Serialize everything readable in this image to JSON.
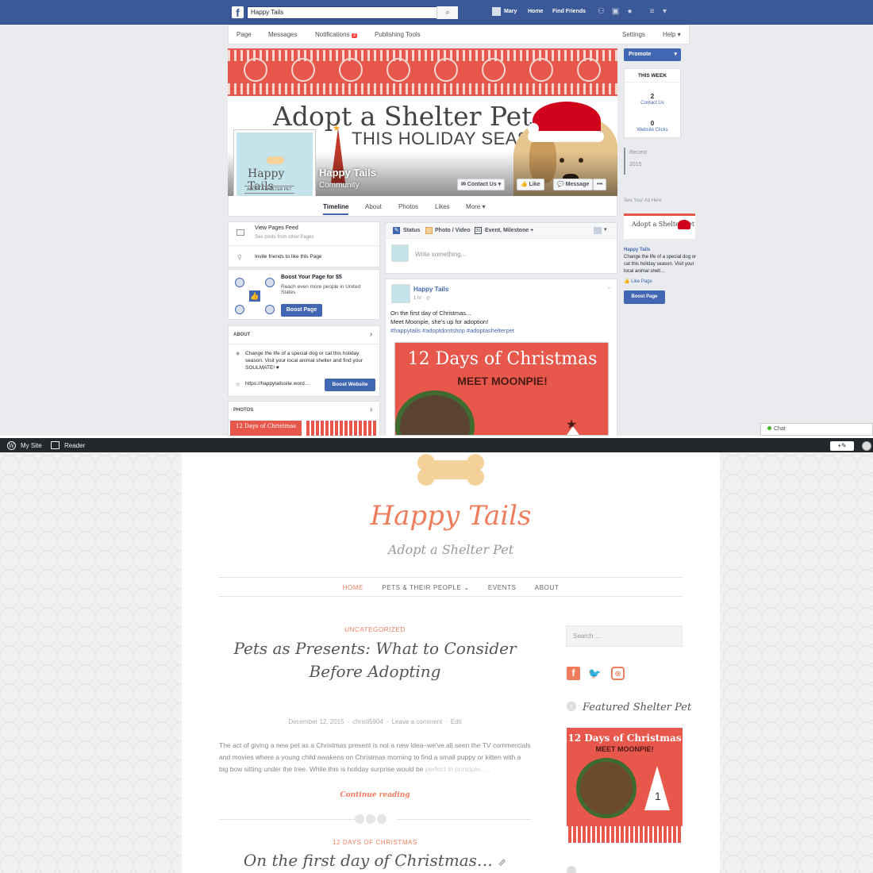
{
  "facebook": {
    "search": {
      "value": "Happy Tails",
      "icon": "search-icon"
    },
    "topnav": {
      "user": "Mary",
      "home": "Home",
      "find_friends": "Find Friends"
    },
    "tabs": {
      "page": "Page",
      "messages": "Messages",
      "notifications": "Notifications",
      "notifications_count": "3",
      "publishing_tools": "Publishing Tools",
      "settings": "Settings",
      "help": "Help ▾"
    },
    "cover": {
      "title": "Adopt a Shelter Pet",
      "subtitle": "THIS HOLIDAY SEASON"
    },
    "profile": {
      "logo_name": "Happy Tails",
      "logo_tagline": "ADOPT A SHELTER PET"
    },
    "page": {
      "name": "Happy Tails",
      "category": "Community"
    },
    "cover_buttons": {
      "contact": "✉ Contact Us ▾",
      "like": "👍 Like",
      "message": "💬 Message",
      "more": "•••"
    },
    "subnav": {
      "timeline": "Timeline",
      "about": "About",
      "photos": "Photos",
      "likes": "Likes",
      "more": "More ▾"
    },
    "right": {
      "promote": "Promote",
      "this_week": "THIS WEEK",
      "contact_count": "2",
      "contact_label": "Contact Us",
      "clicks_count": "0",
      "clicks_label": "Website Clicks",
      "recent": "Recent",
      "year": "2015",
      "ad_label": "See Your Ad Here",
      "ad_title": "Happy Tails",
      "ad_text": "Change the life of a special dog or cat this holiday season. Visit your local animal shelt…",
      "like_page": "Like Page",
      "boost_page": "Boost Page"
    },
    "left": {
      "pages_feed": "View Pages Feed",
      "pages_feed_sub": "See posts from other Pages",
      "invite": "Invite friends to like this Page",
      "boost_title": "Boost Your Page for $5",
      "boost_text": "Reach even more people in United States",
      "boost_button": "Boost Page",
      "about_header": "ABOUT",
      "about_text": "Change the life of a special dog or cat this holiday season. Visit your local animal shelter and find your SOULMATE! ♥",
      "website": "https://happytailssite.word…",
      "boost_website": "Boost Website",
      "photos_header": "PHOTOS",
      "photo_thumb_text": "12 Days of Christmas"
    },
    "composer": {
      "status": "Status",
      "photo_video": "Photo / Video",
      "event": "Event, Milestone +",
      "placeholder": "Write something..."
    },
    "post": {
      "author": "Happy Tails",
      "time": "1 hr · ◎",
      "line1": "On the first day of Christmas...",
      "line2": "Meet Moonpie, she's up for adoption!",
      "hashtags": "#happytails #adoptdontshop #adoptashelterpet",
      "image_title": "12 Days of Christmas",
      "image_sub": "MEET MOONPIE!"
    },
    "chat": "Chat"
  },
  "wordpress": {
    "adminbar": {
      "my_site": "My Site",
      "reader": "Reader",
      "write": "+✎"
    },
    "site_title": "Happy Tails",
    "site_description": "Adopt a Shelter Pet",
    "menu": {
      "home": "HOME",
      "pets": "PETS & THEIR PEOPLE ⌄",
      "events": "EVENTS",
      "about": "ABOUT"
    },
    "post1": {
      "category": "UNCATEGORIZED",
      "title": "Pets as Presents: What to Consider Before Adopting",
      "date": "December 12, 2015",
      "author": "christi5904",
      "comment": "Leave a comment",
      "edit": "Edit",
      "excerpt": "The act of giving a new pet as a Christmas present is not a new idea–we've all seen the TV commercials and movies where a young child awakens on Christmas morning to find a small puppy or kitten with a big bow sitting under the tree. While this is holiday surprise would be",
      "excerpt_fade": "perfect in principle, …",
      "continue": "Continue reading"
    },
    "post2": {
      "category": "12 DAYS OF CHRISTMAS",
      "title": "On the first day of Christmas…"
    },
    "sidebar": {
      "search_placeholder": "Search …",
      "widget_title": "Featured Shelter Pet",
      "featured_title": "12 Days of Christmas",
      "featured_sub": "MEET MOONPIE!",
      "featured_number": "1"
    }
  },
  "colors": {
    "facebook_blue": "#3b5998",
    "accent_coral": "#ef7d5c",
    "cover_red": "#e8574b"
  }
}
